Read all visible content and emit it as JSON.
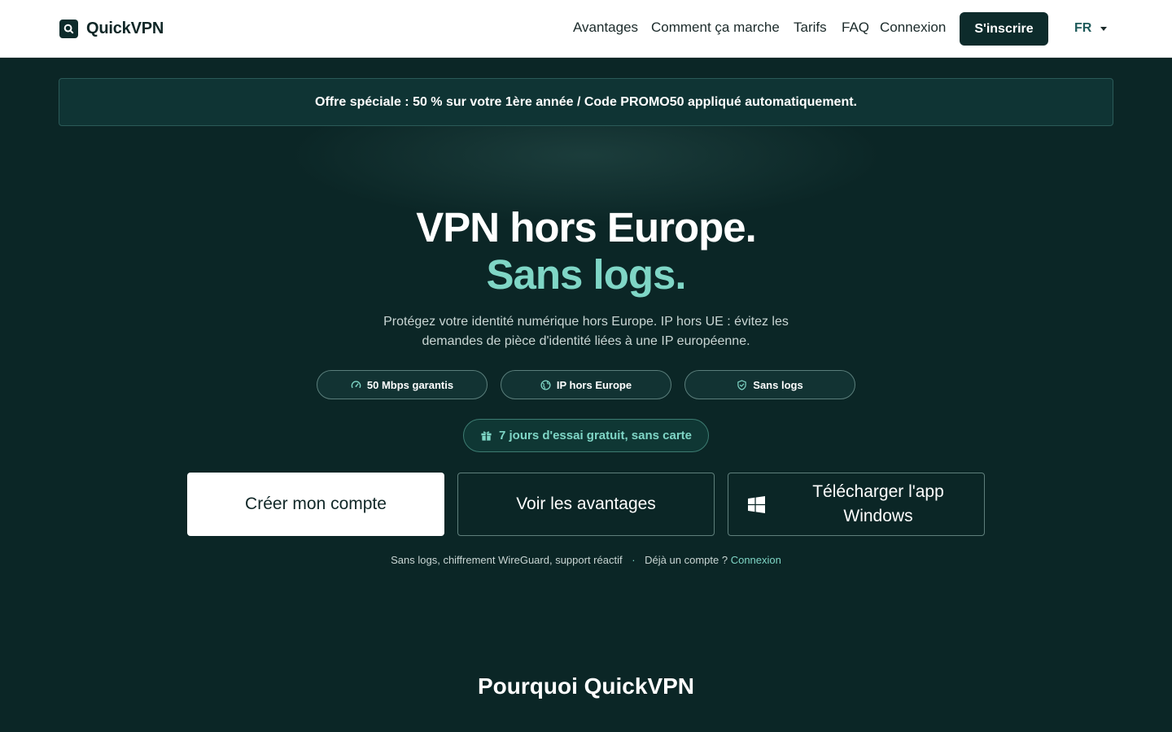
{
  "brand": {
    "name": "QuickVPN",
    "logo_icon": "search-icon"
  },
  "nav": {
    "links": [
      "Avantages",
      "Comment ça marche",
      "Tarifs",
      "FAQ",
      "Connexion"
    ],
    "signup_label": "S'inscrire",
    "language": "FR"
  },
  "promo": {
    "text": "Offre spéciale : 50 % sur votre 1ère année / Code PROMO50 appliqué automatiquement."
  },
  "hero": {
    "title_line1": "VPN hors Europe.",
    "title_line2": "Sans logs.",
    "subtitle": "Protégez votre identité numérique hors Europe. IP hors UE : évitez les demandes de pièce d'identité liées à une IP européenne.",
    "features": [
      {
        "icon": "speedometer-icon",
        "label": "50 Mbps garantis"
      },
      {
        "icon": "globe-icon",
        "label": "IP hors Europe"
      },
      {
        "icon": "shield-check-icon",
        "label": "Sans logs"
      }
    ],
    "trial": {
      "icon": "gift-icon",
      "label": "7 jours d'essai gratuit, sans carte"
    },
    "cta_primary": "Créer mon compte",
    "cta_secondary": "Voir les avantages",
    "cta_download": "Télécharger l'app Windows",
    "footnote": "Sans logs, chiffrement WireGuard, support réactif",
    "footnote_separator": "·",
    "footnote_account": "Déjà un compte ?",
    "footnote_login": "Connexion"
  },
  "section": {
    "title": "Pourquoi QuickVPN"
  },
  "colors": {
    "dark_bg": "#0b2626",
    "accent": "#7fd6c6",
    "nav_dark": "#0d2b2b"
  }
}
